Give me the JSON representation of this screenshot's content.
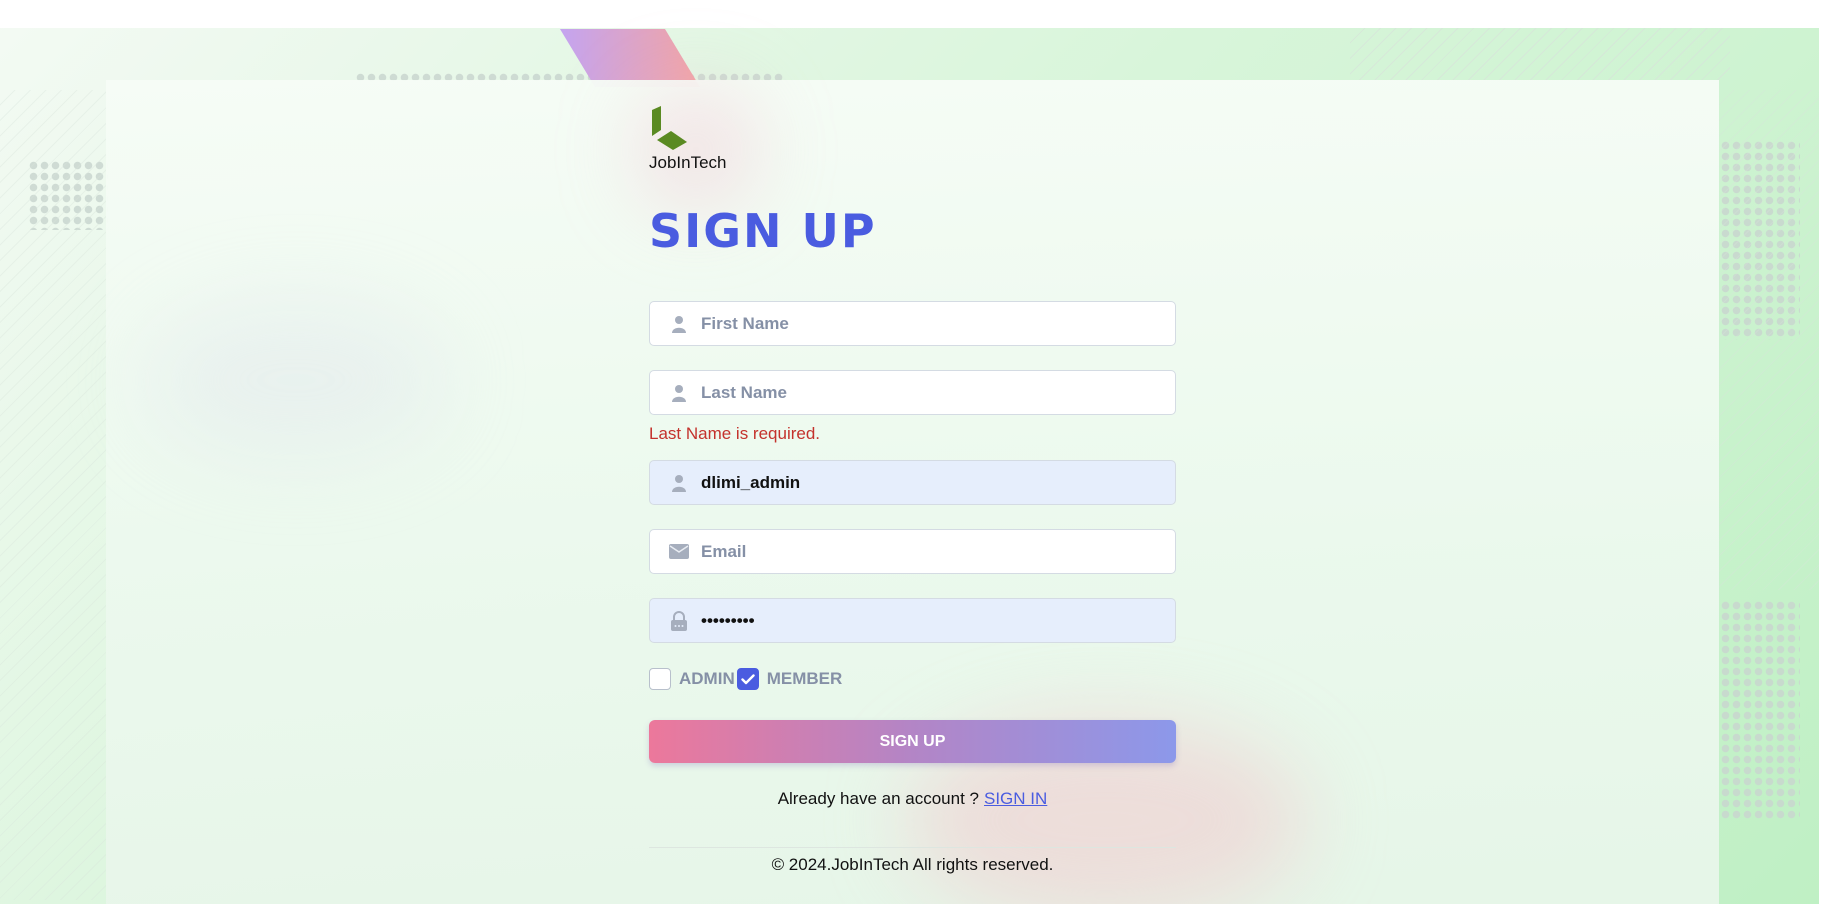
{
  "brand": {
    "name": "JobInTech"
  },
  "title": "SIGN UP",
  "fields": {
    "first_name": {
      "placeholder": "First Name",
      "value": ""
    },
    "last_name": {
      "placeholder": "Last Name",
      "value": "",
      "error": "Last Name is required."
    },
    "username": {
      "placeholder": "",
      "value": "dlimi_admin"
    },
    "email": {
      "placeholder": "Email",
      "value": ""
    },
    "password": {
      "placeholder": "",
      "value": "•••••••••"
    }
  },
  "roles": [
    {
      "label": "ADMIN",
      "checked": false
    },
    {
      "label": "MEMBER",
      "checked": true
    }
  ],
  "signup_button": "SIGN UP",
  "account": {
    "prompt": "Already have an account ?",
    "link": "SIGN IN"
  },
  "footer": "© 2024.JobInTech All rights reserved.",
  "colors": {
    "accent": "#4a5ce0",
    "error": "#c4322c",
    "button_gradient_start": "#ec789b",
    "button_gradient_end": "#8c98ea"
  },
  "icons": [
    "user-icon",
    "envelope-icon",
    "lock-icon",
    "check-icon",
    "logo-leaf-icon"
  ]
}
